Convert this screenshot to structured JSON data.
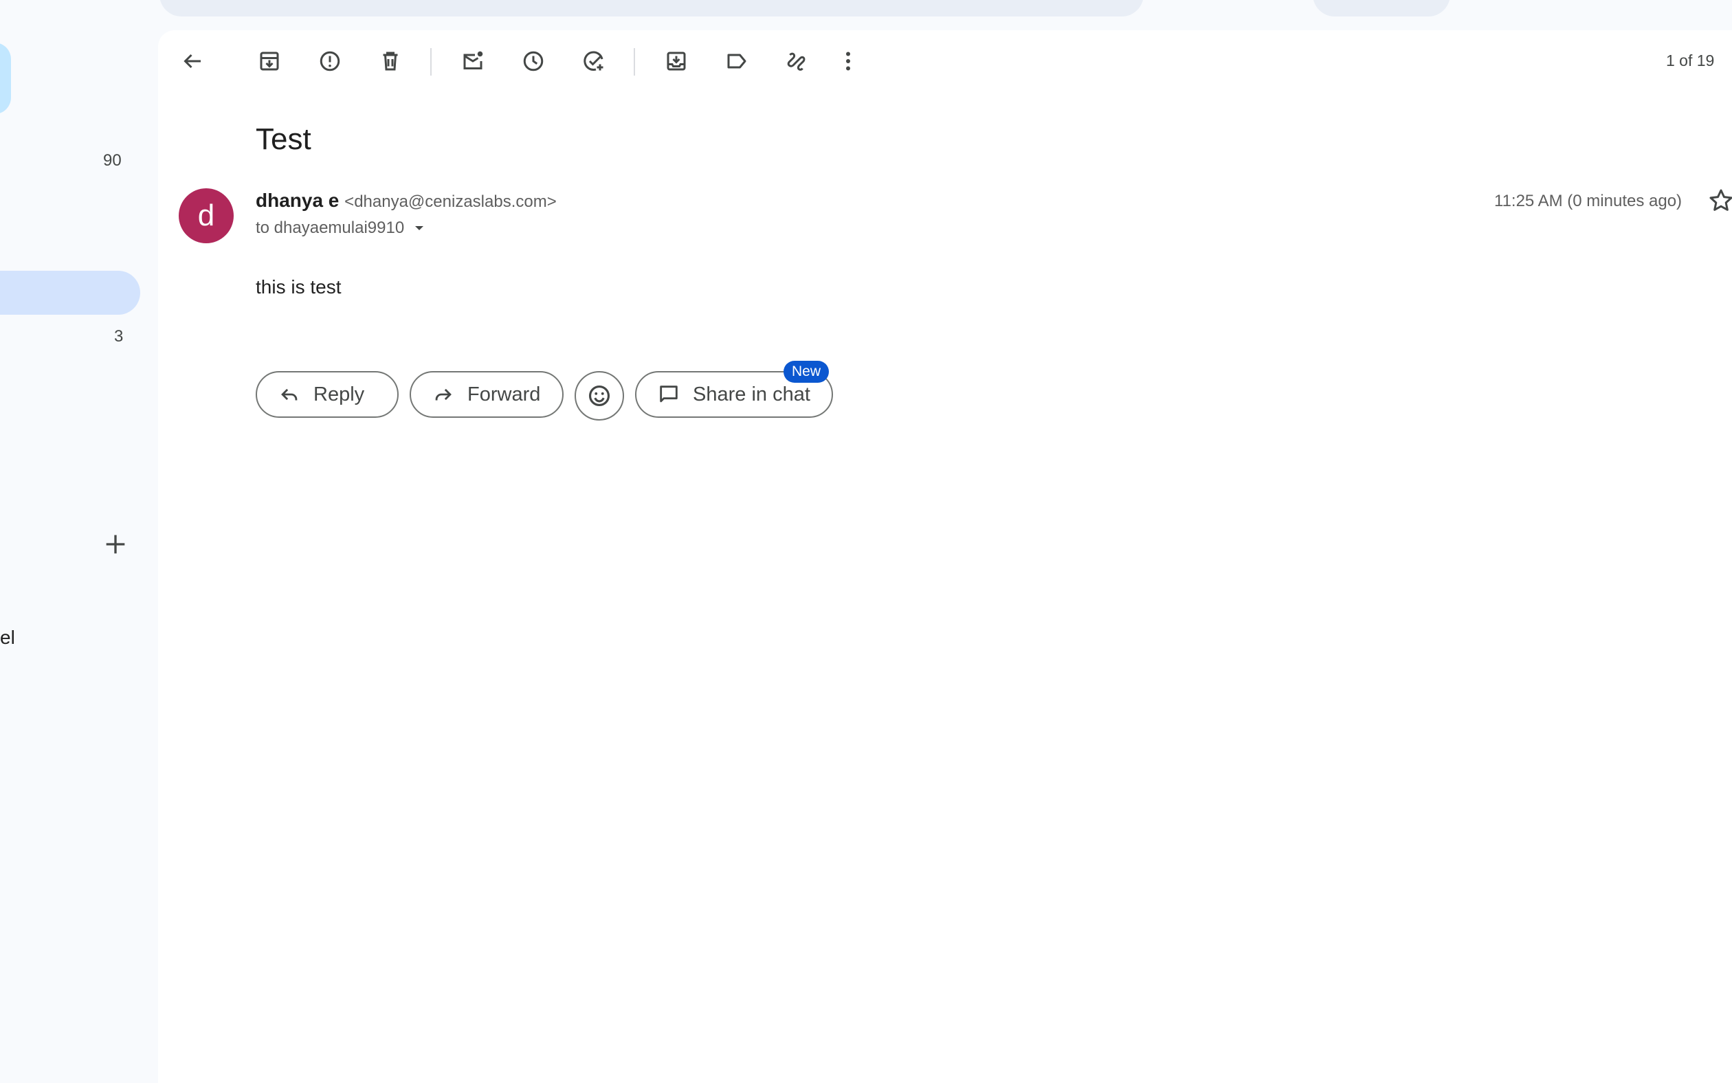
{
  "toolbar": {
    "back_icon": "arrow-left-icon",
    "archive_icon": "archive-icon",
    "spam_icon": "report-spam-icon",
    "delete_icon": "trash-icon",
    "mark_unread_icon": "mark-unread-icon",
    "snooze_icon": "clock-icon",
    "add_task_icon": "add-task-icon",
    "move_to_icon": "move-to-icon",
    "label_icon": "label-icon",
    "more_icon": "more-vert-icon",
    "pager": "1 of 19"
  },
  "sidebar": {
    "count_top": "90",
    "count_active": "3",
    "partial_label": "el"
  },
  "message": {
    "subject": "Test",
    "avatar_letter": "d",
    "avatar_color": "#b0285a",
    "sender_name": "dhanya e",
    "sender_email": "<dhanya@cenizaslabs.com>",
    "to": "to dhayaemulai9910",
    "time": "11:25 AM (0 minutes ago)",
    "body": "this is test"
  },
  "actions": {
    "reply": "Reply",
    "forward": "Forward",
    "share_in_chat": "Share in chat",
    "new_badge": "New"
  },
  "colors": {
    "accent": "#0b57d0",
    "sidebar_active": "#d3e3fd",
    "background": "#f8fafd"
  }
}
